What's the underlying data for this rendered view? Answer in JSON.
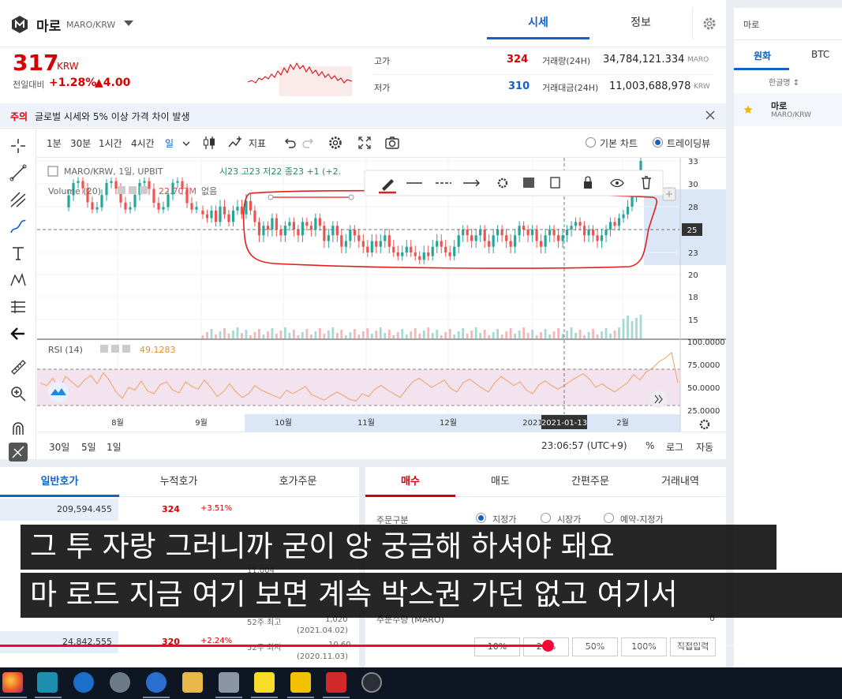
{
  "header": {
    "coin_name": "마로",
    "coin_pair": "MARO/KRW",
    "tabs": [
      {
        "label": "시세"
      },
      {
        "label": "정보"
      }
    ]
  },
  "price": {
    "current": "317",
    "unit": "KRW",
    "change_label": "전일대비",
    "change_rate": "+1.28%",
    "change_amount": "▲4.00",
    "high_label": "고가",
    "high_value": "324",
    "low_label": "저가",
    "low_value": "310",
    "volume_label": "거래량(24H)",
    "volume_value": "34,784,121.334",
    "volume_unit": "MARO",
    "trade_amount_label": "거래대금(24H)",
    "trade_amount_value": "11,003,688,978",
    "trade_amount_unit": "KRW"
  },
  "notice": {
    "tag": "주의",
    "text": "글로벌 시세와 5% 이상 가격 차이 발생"
  },
  "chart_toolbar": {
    "intervals": [
      "1분",
      "30분",
      "1시간",
      "4시간",
      "일"
    ],
    "indicator_label": "지표",
    "basic_chart_label": "기본 차트",
    "tradingview_label": "트레이딩뷰"
  },
  "chart_legend": {
    "symbol": "MARO/KRW, 1일, UPBIT",
    "ohlc": "시23  고23  저22  종23  +1 (+2.",
    "volume_label": "Volume (20)",
    "volume_value": "22.707M",
    "volume_extra": "없음",
    "rsi_label": "RSI (14)",
    "rsi_value": "49.1283"
  },
  "chart_data": {
    "type": "line",
    "title": "",
    "xlabel": "",
    "ylabel": "",
    "x_ticks": [
      "8월",
      "9월",
      "10월",
      "11월",
      "12월",
      "2021",
      "2월"
    ],
    "crosshair_date": "2021-01-13",
    "price_ticks": [
      33,
      30,
      28,
      25,
      23,
      20,
      18,
      15
    ],
    "price_marker": "25",
    "rsi_ticks": [
      "100.0000",
      "75.0000",
      "50.0000",
      "25.0000"
    ],
    "price_close": [
      27,
      26.5,
      27.5,
      26,
      28,
      27,
      26,
      27.5,
      28,
      27,
      28.5,
      27.5,
      26,
      24.5,
      25.5,
      25,
      26.5,
      25,
      24.5,
      25.5,
      26,
      25,
      24.5,
      26,
      25.5,
      25,
      26.5,
      25.5,
      24,
      24.5,
      25.5,
      24.5,
      23.5,
      24,
      25,
      24.5,
      24,
      23.5,
      23,
      24,
      23.5,
      24,
      24.5,
      23.5,
      23,
      22.5,
      23,
      23.5,
      23,
      22.5,
      22,
      23,
      22.5,
      23.5,
      24,
      23.5,
      23,
      22.5,
      23.5,
      24.5,
      25,
      24.5,
      24,
      24.5,
      25,
      24,
      23.5,
      24.5,
      25,
      24.5,
      24,
      23.5,
      24.5,
      25.5,
      25,
      24.5,
      25,
      24,
      23.5,
      24.5,
      25,
      24.5,
      24,
      24.5,
      25,
      25.5,
      26,
      25.5,
      24.5,
      25,
      24.5,
      24,
      24.5,
      25,
      26,
      25.5,
      26.5,
      27,
      28,
      29,
      31,
      33
    ],
    "rsi": [
      55,
      52,
      60,
      48,
      62,
      56,
      50,
      58,
      63,
      54,
      66,
      57,
      45,
      38,
      50,
      47,
      57,
      46,
      43,
      53,
      56,
      47,
      44,
      56,
      51,
      48,
      58,
      50,
      40,
      45,
      54,
      45,
      39,
      43,
      52,
      47,
      44,
      41,
      38,
      47,
      43,
      47,
      51,
      42,
      39,
      36,
      41,
      45,
      41,
      37,
      35,
      43,
      40,
      48,
      52,
      47,
      43,
      39,
      48,
      56,
      60,
      55,
      50,
      54,
      58,
      49,
      45,
      55,
      59,
      54,
      49,
      45,
      55,
      62,
      57,
      52,
      56,
      47,
      43,
      53,
      57,
      52,
      48,
      52,
      57,
      61,
      65,
      59,
      50,
      54,
      49,
      45,
      50,
      55,
      64,
      58,
      67,
      71,
      78,
      82,
      88,
      55
    ]
  },
  "bottom_bar": {
    "ranges": [
      "30일",
      "5일",
      "1일"
    ],
    "clock": "23:06:57 (UTC+9)",
    "percent": "%",
    "log": "로그",
    "auto": "자동"
  },
  "right_panel": {
    "search_placeholder": "마로",
    "tabs": [
      "원화",
      "BTC"
    ],
    "column_header": "한글명 ↕",
    "coin_name": "마로",
    "coin_pair": "MARO/KRW"
  },
  "orderbook": {
    "tabs": [
      "일반호가",
      "누적호가",
      "호가주문"
    ],
    "rows": [
      {
        "volume": "209,594.455",
        "price": "324",
        "rate": "+3.51%"
      },
      {
        "volume": "24,842,555",
        "price": "320",
        "rate": "+2.24%"
      }
    ],
    "side": {
      "trade_amount": "11,004",
      "week52_high_label": "52주 최고",
      "week52_high": "1,020",
      "week52_high_date": "(2021.04.02)",
      "week52_low_label": "52주 최저",
      "week52_low": "10.60",
      "week52_low_date": "(2020.11.03)"
    }
  },
  "orderform": {
    "tabs": [
      "매수",
      "매도",
      "간편주문",
      "거래내역"
    ],
    "order_type_label": "주문구분",
    "order_types": [
      "지정가",
      "시장가",
      "예약-지정가"
    ],
    "qty_label": "주문수량 (MARO)",
    "qty_value": "0",
    "pct_buttons": [
      "10%",
      "25%",
      "50%",
      "100%",
      "직접입력"
    ]
  },
  "subtitles": {
    "line1": "그 투 자랑 그러니까 굳이 앙 궁금해 하셔야 돼요",
    "line2": "마 로드 지금 여기 보면 계속 박스권 가던 없고 여기서"
  },
  "video": {
    "progress": 0.65
  },
  "colors": {
    "accent": "#1261c4",
    "up": "#d60000",
    "down": "#1261c4",
    "rsi_line": "#f0a060",
    "rsi_band": "#f3e3ee",
    "annotation": "#e02020"
  }
}
